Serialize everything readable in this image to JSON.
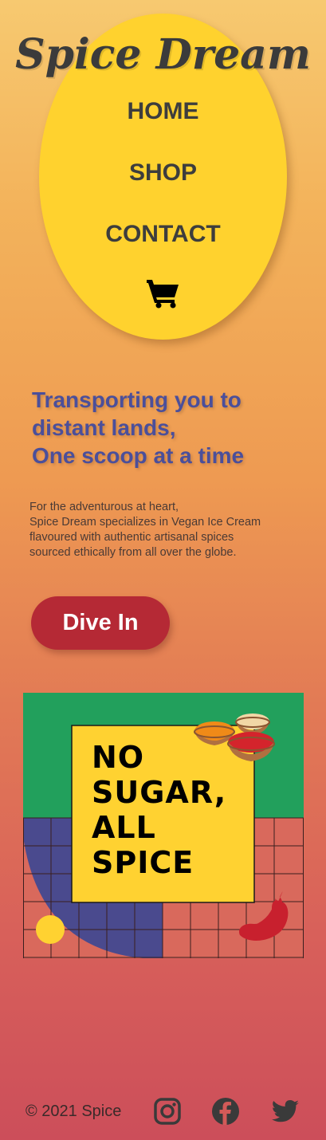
{
  "header": {
    "brand": "Spice Dream",
    "nav": [
      {
        "label": "HOME"
      },
      {
        "label": "SHOP"
      },
      {
        "label": "CONTACT"
      }
    ],
    "cart_icon": "shopping-cart-icon"
  },
  "hero": {
    "headline": [
      "Transporting you to",
      "distant lands,",
      "One scoop at a time"
    ],
    "description": [
      "For the adventurous at heart,",
      "Spice Dream specializes in Vegan Ice Cream",
      "flavoured with authentic artisanal spices",
      "sourced ethically from all over the globe."
    ],
    "cta_label": "Dive In"
  },
  "promo": {
    "lines": [
      "NO",
      "SUGAR,",
      "ALL",
      "SPICE"
    ]
  },
  "footer": {
    "copyright": "© 2021 Spice",
    "social": [
      "instagram-icon",
      "facebook-icon",
      "twitter-icon"
    ]
  },
  "colors": {
    "oval": "#ffd22e",
    "headline": "#4b4f9a",
    "cta": "#b52935",
    "green": "#22a05c",
    "navy": "#4a4a8e",
    "yellow": "#ffd231"
  }
}
